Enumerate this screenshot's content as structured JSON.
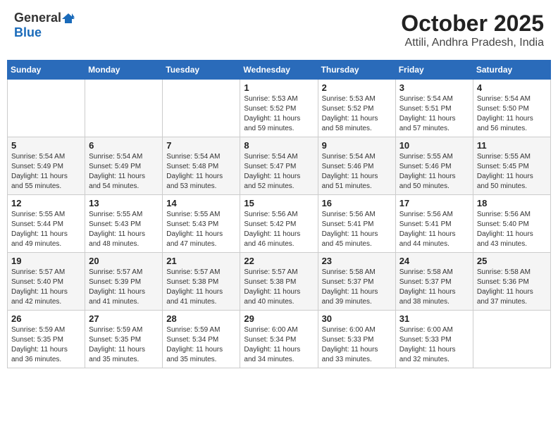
{
  "header": {
    "logo_general": "General",
    "logo_blue": "Blue",
    "month_title": "October 2025",
    "location": "Attili, Andhra Pradesh, India"
  },
  "weekdays": [
    "Sunday",
    "Monday",
    "Tuesday",
    "Wednesday",
    "Thursday",
    "Friday",
    "Saturday"
  ],
  "weeks": [
    [
      {
        "day": "",
        "info": ""
      },
      {
        "day": "",
        "info": ""
      },
      {
        "day": "",
        "info": ""
      },
      {
        "day": "1",
        "info": "Sunrise: 5:53 AM\nSunset: 5:52 PM\nDaylight: 11 hours\nand 59 minutes."
      },
      {
        "day": "2",
        "info": "Sunrise: 5:53 AM\nSunset: 5:52 PM\nDaylight: 11 hours\nand 58 minutes."
      },
      {
        "day": "3",
        "info": "Sunrise: 5:54 AM\nSunset: 5:51 PM\nDaylight: 11 hours\nand 57 minutes."
      },
      {
        "day": "4",
        "info": "Sunrise: 5:54 AM\nSunset: 5:50 PM\nDaylight: 11 hours\nand 56 minutes."
      }
    ],
    [
      {
        "day": "5",
        "info": "Sunrise: 5:54 AM\nSunset: 5:49 PM\nDaylight: 11 hours\nand 55 minutes."
      },
      {
        "day": "6",
        "info": "Sunrise: 5:54 AM\nSunset: 5:49 PM\nDaylight: 11 hours\nand 54 minutes."
      },
      {
        "day": "7",
        "info": "Sunrise: 5:54 AM\nSunset: 5:48 PM\nDaylight: 11 hours\nand 53 minutes."
      },
      {
        "day": "8",
        "info": "Sunrise: 5:54 AM\nSunset: 5:47 PM\nDaylight: 11 hours\nand 52 minutes."
      },
      {
        "day": "9",
        "info": "Sunrise: 5:54 AM\nSunset: 5:46 PM\nDaylight: 11 hours\nand 51 minutes."
      },
      {
        "day": "10",
        "info": "Sunrise: 5:55 AM\nSunset: 5:46 PM\nDaylight: 11 hours\nand 50 minutes."
      },
      {
        "day": "11",
        "info": "Sunrise: 5:55 AM\nSunset: 5:45 PM\nDaylight: 11 hours\nand 50 minutes."
      }
    ],
    [
      {
        "day": "12",
        "info": "Sunrise: 5:55 AM\nSunset: 5:44 PM\nDaylight: 11 hours\nand 49 minutes."
      },
      {
        "day": "13",
        "info": "Sunrise: 5:55 AM\nSunset: 5:43 PM\nDaylight: 11 hours\nand 48 minutes."
      },
      {
        "day": "14",
        "info": "Sunrise: 5:55 AM\nSunset: 5:43 PM\nDaylight: 11 hours\nand 47 minutes."
      },
      {
        "day": "15",
        "info": "Sunrise: 5:56 AM\nSunset: 5:42 PM\nDaylight: 11 hours\nand 46 minutes."
      },
      {
        "day": "16",
        "info": "Sunrise: 5:56 AM\nSunset: 5:41 PM\nDaylight: 11 hours\nand 45 minutes."
      },
      {
        "day": "17",
        "info": "Sunrise: 5:56 AM\nSunset: 5:41 PM\nDaylight: 11 hours\nand 44 minutes."
      },
      {
        "day": "18",
        "info": "Sunrise: 5:56 AM\nSunset: 5:40 PM\nDaylight: 11 hours\nand 43 minutes."
      }
    ],
    [
      {
        "day": "19",
        "info": "Sunrise: 5:57 AM\nSunset: 5:40 PM\nDaylight: 11 hours\nand 42 minutes."
      },
      {
        "day": "20",
        "info": "Sunrise: 5:57 AM\nSunset: 5:39 PM\nDaylight: 11 hours\nand 41 minutes."
      },
      {
        "day": "21",
        "info": "Sunrise: 5:57 AM\nSunset: 5:38 PM\nDaylight: 11 hours\nand 41 minutes."
      },
      {
        "day": "22",
        "info": "Sunrise: 5:57 AM\nSunset: 5:38 PM\nDaylight: 11 hours\nand 40 minutes."
      },
      {
        "day": "23",
        "info": "Sunrise: 5:58 AM\nSunset: 5:37 PM\nDaylight: 11 hours\nand 39 minutes."
      },
      {
        "day": "24",
        "info": "Sunrise: 5:58 AM\nSunset: 5:37 PM\nDaylight: 11 hours\nand 38 minutes."
      },
      {
        "day": "25",
        "info": "Sunrise: 5:58 AM\nSunset: 5:36 PM\nDaylight: 11 hours\nand 37 minutes."
      }
    ],
    [
      {
        "day": "26",
        "info": "Sunrise: 5:59 AM\nSunset: 5:35 PM\nDaylight: 11 hours\nand 36 minutes."
      },
      {
        "day": "27",
        "info": "Sunrise: 5:59 AM\nSunset: 5:35 PM\nDaylight: 11 hours\nand 35 minutes."
      },
      {
        "day": "28",
        "info": "Sunrise: 5:59 AM\nSunset: 5:34 PM\nDaylight: 11 hours\nand 35 minutes."
      },
      {
        "day": "29",
        "info": "Sunrise: 6:00 AM\nSunset: 5:34 PM\nDaylight: 11 hours\nand 34 minutes."
      },
      {
        "day": "30",
        "info": "Sunrise: 6:00 AM\nSunset: 5:33 PM\nDaylight: 11 hours\nand 33 minutes."
      },
      {
        "day": "31",
        "info": "Sunrise: 6:00 AM\nSunset: 5:33 PM\nDaylight: 11 hours\nand 32 minutes."
      },
      {
        "day": "",
        "info": ""
      }
    ]
  ]
}
